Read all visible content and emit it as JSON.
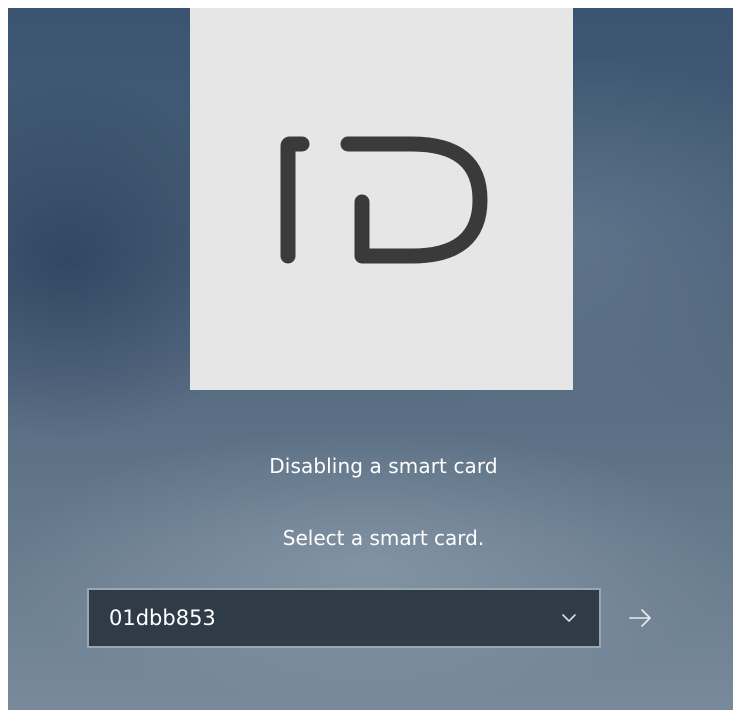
{
  "logon": {
    "tile_icon": "smart-card-id-icon",
    "title": "Disabling a smart card",
    "subtitle": "Select a smart card.",
    "card_select": {
      "selected_value": "01dbb853",
      "dropdown_icon": "chevron-down-icon"
    },
    "submit_icon": "arrow-right-icon"
  },
  "colors": {
    "tile_background": "#e6e6e6",
    "tile_glyph": "#3a3a3a",
    "select_background": "#2f3b47",
    "select_border": "#9aa6b2",
    "text": "#ffffff"
  }
}
